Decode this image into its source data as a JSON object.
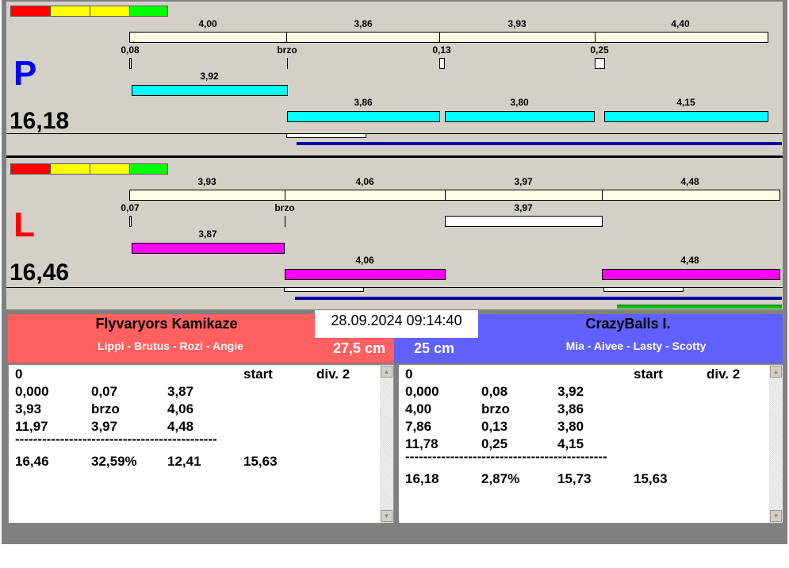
{
  "colors": {
    "red": "#ff0000",
    "yellow": "#ffff00",
    "green": "#00ff00",
    "cyan": "#00ffff",
    "magenta": "#ff00ff",
    "left_team": "#ff6060",
    "right_team": "#6060ff"
  },
  "lane_p": {
    "letter": "P",
    "total": "16,18",
    "top_labels": [
      "4,00",
      "3,86",
      "3,93",
      "4,40"
    ],
    "mid_labels": [
      "0,08",
      "brzo",
      "0,13",
      "0,25"
    ],
    "first_bar": "3,92",
    "lower_labels": [
      "3,86",
      "3,80",
      "4,15"
    ]
  },
  "lane_l": {
    "letter": "L",
    "total": "16,46",
    "top_labels": [
      "3,93",
      "4,06",
      "3,97",
      "4,48"
    ],
    "mid_labels": [
      "0,07",
      "brzo",
      "3,97"
    ],
    "first_bar": "3,87",
    "lower_labels": [
      "4,06",
      "4,48"
    ]
  },
  "datetime": "28.09.2024 09:14:40",
  "left_team": {
    "name": "Flyvaryors Kamikaze",
    "players": "Lippi - Brutus - Rozi - Angie",
    "distance": "27,5 cm",
    "rows": [
      [
        "0",
        "",
        "",
        "start",
        "div. 2"
      ],
      [
        "0,000",
        "0,07",
        "3,87",
        "",
        ""
      ],
      [
        "3,93",
        "brzo",
        "4,06",
        "",
        ""
      ],
      [
        "11,97",
        "3,97",
        "4,48",
        "",
        ""
      ]
    ],
    "separator": "---------------------------------------------",
    "summary": [
      "16,46",
      "32,59%",
      "12,41",
      "15,63"
    ]
  },
  "right_team": {
    "name": "CrazyBalls I.",
    "players": "Mia - Aivee - Lasty - Scotty",
    "distance": "25 cm",
    "rows": [
      [
        "0",
        "",
        "",
        "start",
        "div. 2"
      ],
      [
        "0,000",
        "0,08",
        "3,92",
        "",
        ""
      ],
      [
        "4,00",
        "brzo",
        "3,86",
        "",
        ""
      ],
      [
        "7,86",
        "0,13",
        "3,80",
        "",
        ""
      ],
      [
        "11,78",
        "0,25",
        "4,15",
        "",
        ""
      ]
    ],
    "separator": "---------------------------------------------",
    "summary": [
      "16,18",
      "2,87%",
      "15,73",
      "15,63"
    ]
  }
}
